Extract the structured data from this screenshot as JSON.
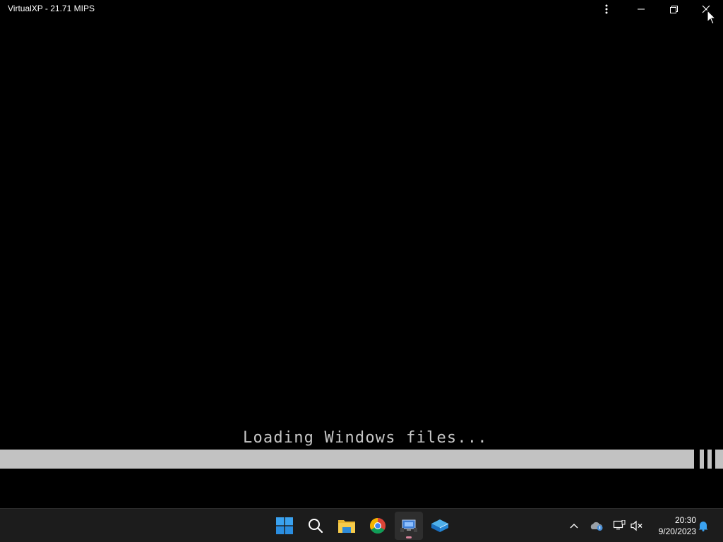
{
  "window": {
    "title": "VirtualXP - 21.71 MIPS",
    "controls": {
      "more": "more-options",
      "minimize": "minimize",
      "restore": "restore",
      "close": "close"
    }
  },
  "vm_screen": {
    "loading_text": "Loading Windows files...",
    "progress_fraction": 0.96,
    "progress_color": "#c2c2c2"
  },
  "taskbar": {
    "apps": [
      {
        "icon": "windows-start-icon"
      },
      {
        "icon": "search-icon"
      },
      {
        "icon": "file-explorer-icon"
      },
      {
        "icon": "chrome-icon"
      },
      {
        "icon": "virtualxp-icon",
        "active": true
      },
      {
        "icon": "virtualbox-icon"
      }
    ],
    "tray": {
      "icons": [
        "chevron-up-icon",
        "onedrive-icon",
        "network-icon",
        "volume-muted-icon",
        "notification-bell-icon"
      ],
      "time": "20:30",
      "date": "9/20/2023"
    },
    "accent_color": "#d9839b"
  }
}
